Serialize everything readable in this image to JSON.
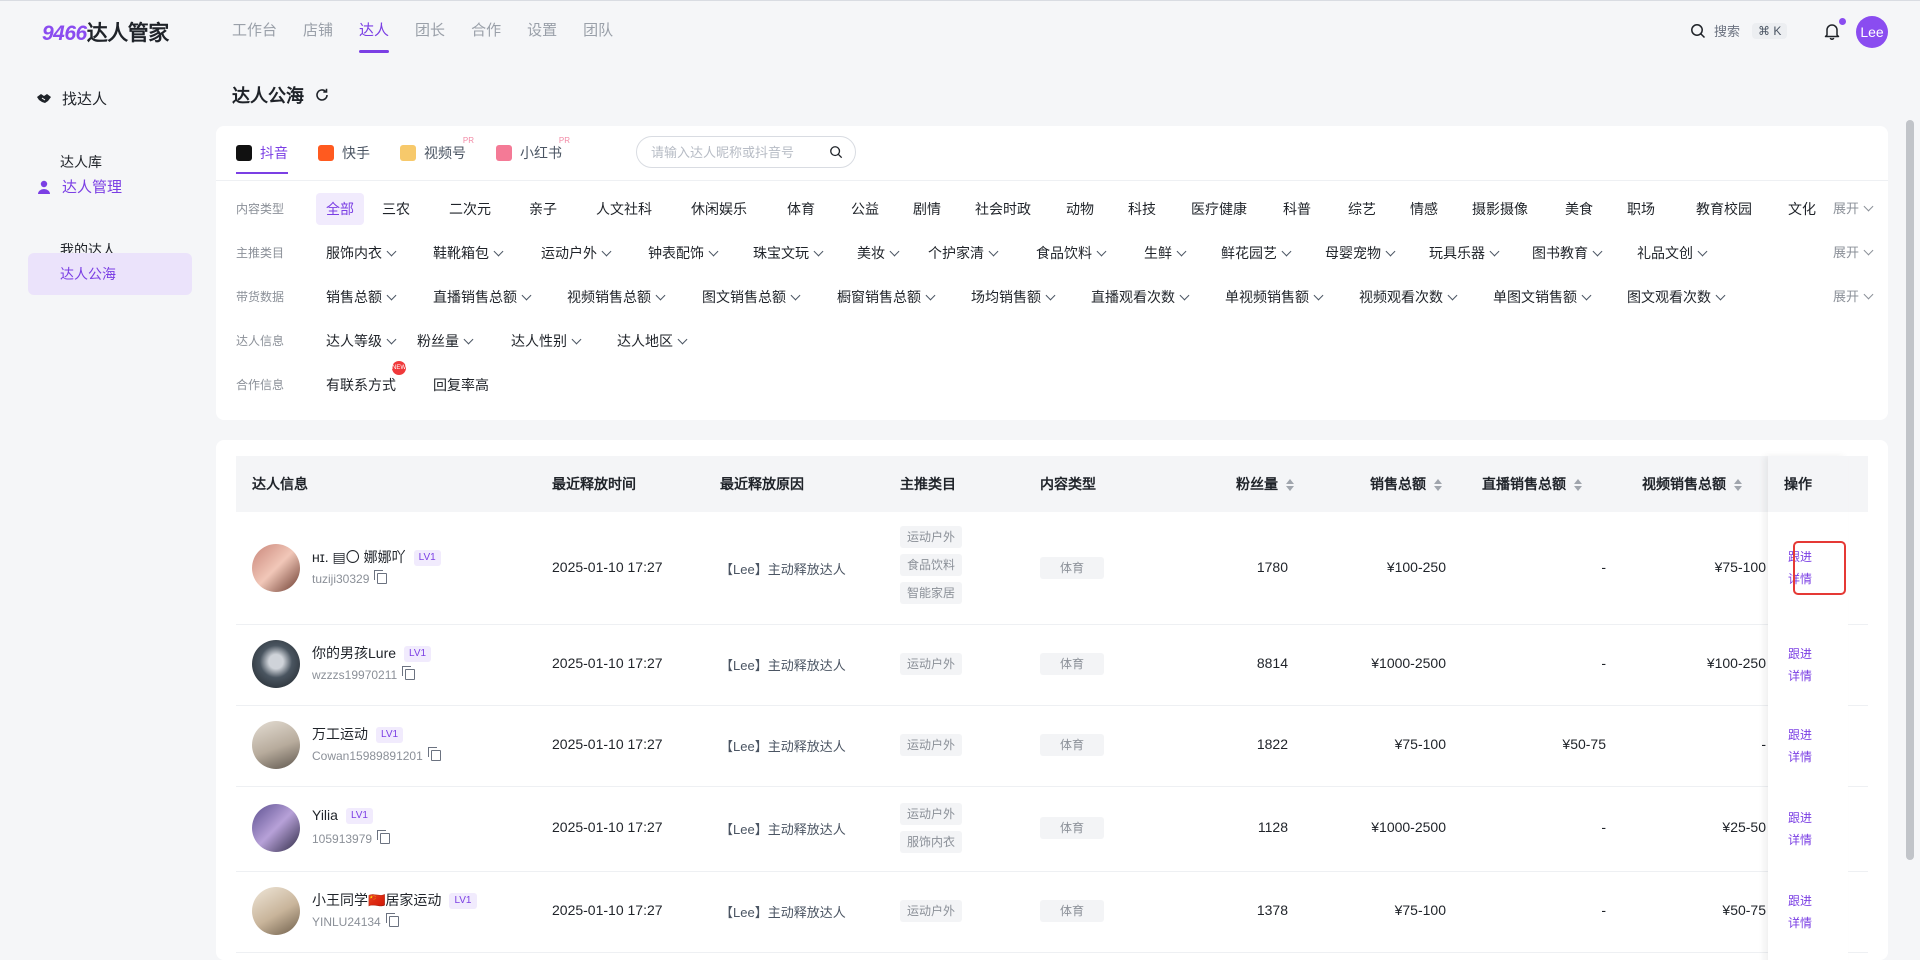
{
  "app": {
    "logo_num": "9466",
    "logo_text": "达人管家"
  },
  "nav": [
    "工作台",
    "店铺",
    "达人",
    "团长",
    "合作",
    "设置",
    "团队"
  ],
  "header": {
    "search_label": "搜索",
    "search_shortcut": "⌘ K",
    "user_initials": "Lee"
  },
  "sidebar": {
    "group1": "找达人",
    "item_library": "达人库",
    "group2": "达人管理",
    "item_mine": "我的达人",
    "item_public": "达人公海"
  },
  "page": {
    "title": "达人公海"
  },
  "platforms": [
    "抖音",
    "快手",
    "视频号",
    "小红书"
  ],
  "platform_sup": "PR",
  "search": {
    "placeholder": "请输入达人昵称或抖音号"
  },
  "filters": {
    "expand_label": "展开",
    "content_type": {
      "label": "内容类型",
      "options": [
        "全部",
        "三农",
        "二次元",
        "亲子",
        "人文社科",
        "休闲娱乐",
        "体育",
        "公益",
        "剧情",
        "社会时政",
        "动物",
        "科技",
        "医疗健康",
        "科普",
        "综艺",
        "情感",
        "摄影摄像",
        "美食",
        "职场",
        "教育校园",
        "文化"
      ]
    },
    "category": {
      "label": "主推类目",
      "options": [
        "服饰内衣",
        "鞋靴箱包",
        "运动户外",
        "钟表配饰",
        "珠宝文玩",
        "美妆",
        "个护家清",
        "食品饮料",
        "生鲜",
        "鲜花园艺",
        "母婴宠物",
        "玩具乐器",
        "图书教育",
        "礼品文创"
      ]
    },
    "sales_data": {
      "label": "带货数据",
      "options": [
        "销售总额",
        "直播销售总额",
        "视频销售总额",
        "图文销售总额",
        "橱窗销售总额",
        "场均销售额",
        "直播观看次数",
        "单视频销售额",
        "视频观看次数",
        "单图文销售额",
        "图文观看次数"
      ]
    },
    "creator_info": {
      "label": "达人信息",
      "options": [
        "达人等级",
        "粉丝量",
        "达人性别",
        "达人地区"
      ]
    },
    "coop_info": {
      "label": "合作信息",
      "options": [
        "有联系方式",
        "回复率高"
      ],
      "new_badge": "NEW"
    }
  },
  "table": {
    "headers": [
      "达人信息",
      "最近释放时间",
      "最近释放原因",
      "主推类目",
      "内容类型",
      "粉丝量",
      "销售总额",
      "直播销售总额",
      "视频销售总额",
      "操作"
    ],
    "rows": [
      {
        "nickname": "ʜɪ. ▤〇 娜娜吖",
        "level": "LV1",
        "uid": "tuziji30329",
        "release_time": "2025-01-10 17:27",
        "reason": "【Lee】主动释放达人",
        "categories": [
          "运动户外",
          "食品饮料",
          "智能家居"
        ],
        "content_type": "体育",
        "fans": "1780",
        "sales_total": "¥100-250",
        "live_sales": "-",
        "video_sales": "¥75-100",
        "op1": "跟进",
        "op2": "详情"
      },
      {
        "nickname": "你的男孩Lure",
        "level": "LV1",
        "uid": "wzzzs19970211",
        "release_time": "2025-01-10 17:27",
        "reason": "【Lee】主动释放达人",
        "categories": [
          "运动户外"
        ],
        "content_type": "体育",
        "fans": "8814",
        "sales_total": "¥1000-2500",
        "live_sales": "-",
        "video_sales": "¥100-250",
        "op1": "跟进",
        "op2": "详情"
      },
      {
        "nickname": "万工运动",
        "level": "LV1",
        "uid": "Cowan15989891201",
        "release_time": "2025-01-10 17:27",
        "reason": "【Lee】主动释放达人",
        "categories": [
          "运动户外"
        ],
        "content_type": "体育",
        "fans": "1822",
        "sales_total": "¥75-100",
        "live_sales": "¥50-75",
        "video_sales": "-",
        "op1": "跟进",
        "op2": "详情"
      },
      {
        "nickname": "Yilia",
        "level": "LV1",
        "uid": "105913979",
        "release_time": "2025-01-10 17:27",
        "reason": "【Lee】主动释放达人",
        "categories": [
          "运动户外",
          "服饰内衣"
        ],
        "content_type": "体育",
        "fans": "1128",
        "sales_total": "¥1000-2500",
        "live_sales": "-",
        "video_sales": "¥25-50",
        "op1": "跟进",
        "op2": "详情"
      },
      {
        "nickname": "小王同学🇨🇳居家运动",
        "level": "LV1",
        "uid": "YINLU24134",
        "release_time": "2025-01-10 17:27",
        "reason": "【Lee】主动释放达人",
        "categories": [
          "运动户外"
        ],
        "content_type": "体育",
        "fans": "1378",
        "sales_total": "¥75-100",
        "live_sales": "-",
        "video_sales": "¥50-75",
        "op1": "跟进",
        "op2": "详情"
      }
    ]
  },
  "colors": {
    "accent": "#7b3fe4",
    "highlight": "#e53935"
  }
}
